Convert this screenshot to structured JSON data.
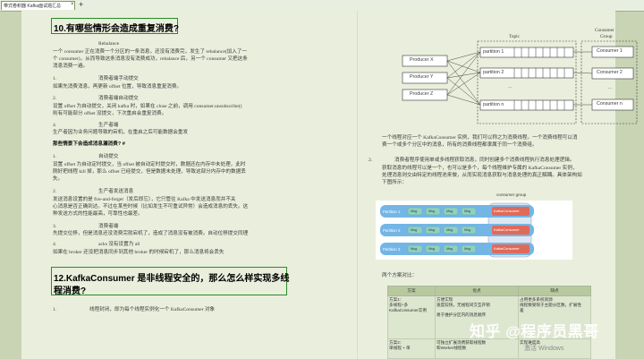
{
  "tab": {
    "title": "带式卷积器 Kafka面试题汇总",
    "close": "×",
    "new": "+"
  },
  "left": {
    "q10": "10.有哪些情形会造成重复消费?",
    "rebalance_title": "Rebalance",
    "rebalance_l1": "一个 consumer 正在消费一个分区的一条消息，还没有消费完，发生了 rebalance(加入了一",
    "rebalance_l2": "个 consumer)，从而导致这条消息没有消费成功，rebalance 后，另一个 consumer 又把这条",
    "rebalance_l3": "消息消费一遍。",
    "n1": "1.",
    "n1_title": "消费者端手动提交",
    "n1_text": "如果先消费消息，再更新 offset 位置，导致消息重复消费。",
    "n2": "2.",
    "n2_title": "消费者端自动提交",
    "n2_l1": "设置 offset 为自动提交，关闭 kafka 时，如果在 close 之前，调用 consumer.unsubscribe()",
    "n2_l2": "则有可能部分 offset 没提交，下次重启会重复消费。",
    "n4": "4.",
    "n4_title": "生产者端",
    "n4_text": "生产者因为业务问题导致的宕机，在重启之后可能数据会重发",
    "sub": "那些情景下会造成消息漏消费? #",
    "m1": "1.",
    "m1_title": "自动提交",
    "m1_l1": "设置 offset 为自动定时提交，当 offset 被自动定时提交时，数据还在内存中未处理，此时",
    "m1_l2": "刚好把线程 kill 掉，那么 offset 已经提交，但是数据未处理，导致这部分内存中的数据丢",
    "m1_l3": "失。",
    "m2": "2.",
    "m2_title": "生产者发送消息",
    "m2_l1": "发送消息设置的是 fire-and-forget（发后即忘），它只管往 Kafka 中发送消息而并不关",
    "m2_l2": "心消息是否正确到达。不过在某些时候（比如发生不可重试异常）会造成消息的丢失。这",
    "m2_l3": "种发送方式的性能最高，可靠性也最差。",
    "m3": "3.",
    "m3_title": "消费者端",
    "m3_text": "先提交位移，但是消息还没消费完就宕机了，造成了消息没有被消费。自动位移提交同理",
    "m4": "4.",
    "m4_title": "acks 没有设置为 all",
    "m4_text": "如果在 broker 还没把消息同步到其他 broker 的时候宕机了，那么消息将会丢失",
    "q12_l1": "12.KafkaConsumer 是非线程安全的，那么怎么样实现多线",
    "q12_l2": "程消费?",
    "p1": "1.",
    "p1_text": "线程封闭，即为每个线程实例化一个 KafkaConsumer 对象"
  },
  "diagram1": {
    "topic": "Topic",
    "cg1": "Consumer",
    "cg2": "Group",
    "producers": [
      "Producer X",
      "Producer Y",
      "Producer Z"
    ],
    "partitions": [
      "partition 1",
      "partition 2",
      "partition n"
    ],
    "consumers": [
      "Consumer 1",
      "Consumer 2",
      "Consumer n"
    ],
    "dots": "..."
  },
  "right": {
    "cap1": "一个线程对应一个 KafkaConsumer 实例，我们可以称之为消费线程。一个消费线程可以消",
    "cap2": "费一个或多个分区中的消息，所有的消费线程都隶属于同一个消费组。",
    "n2": "2.",
    "r_l1": "消费者程序使用单或多线程获取消息，同时创建多个消费线程执行消息处理逻辑。",
    "r_l2": "获取消息的线程可以是一个，也可以是多个，每个线程维护专属的 KafkaConsumer 实例，",
    "r_l3": "处理消息则交由特定的线程池来做，从而实现消息获取与消息处理的真正解耦。具体架构如",
    "r_l4": "下图所示："
  },
  "diagram2": {
    "group": "consumer group",
    "rows": [
      "Partition 1",
      "Partition 2",
      "Partition 3"
    ],
    "msg": "Msg",
    "kc": "KafkaConsumer"
  },
  "table": {
    "caption": "两个方案对比：",
    "headers": [
      "方案",
      "优点",
      "缺点"
    ],
    "rows": [
      {
        "plan": "方案1：\n多线程+多\nKafkaConsumer实例",
        "pros": "方便实现\n速度较快，无线程间交互开销\n\n易于维护分区内的消息顺序",
        "cons": "占用更多系统资源\n线程数受限于主题分区数，扩展性\n差"
      },
      {
        "plan": "方案2：\n单线程 + 单",
        "pros": "可独立扩展消费获取线程数\n和Worker线程数",
        "cons": "实现难度高"
      }
    ]
  },
  "watermark": "知乎 @程序员黑哥",
  "activate": "激活 Windows"
}
